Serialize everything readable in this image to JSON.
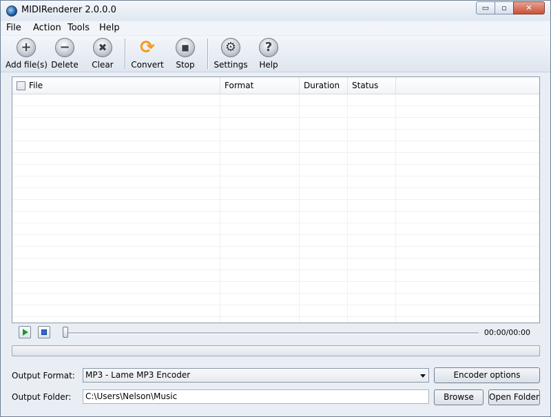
{
  "window": {
    "title": "MIDIRenderer 2.0.0.0",
    "min_glyph": "▭",
    "max_glyph": "▫",
    "close_glyph": "✕"
  },
  "menu": [
    "File",
    "Action",
    "Tools",
    "Help"
  ],
  "toolbar": {
    "add": {
      "label": "Add file(s)",
      "glyph": "+"
    },
    "delete": {
      "label": "Delete",
      "glyph": "−"
    },
    "clear": {
      "label": "Clear",
      "glyph": "✖"
    },
    "convert": {
      "label": "Convert",
      "glyph": "⟳"
    },
    "stop": {
      "label": "Stop",
      "glyph": "■"
    },
    "settings": {
      "label": "Settings",
      "glyph": "⚙"
    },
    "help": {
      "label": "Help",
      "glyph": "?"
    }
  },
  "list": {
    "columns": [
      "File",
      "Format",
      "Duration",
      "Status"
    ]
  },
  "player": {
    "time": "00:00/00:00"
  },
  "output": {
    "format_label": "Output Format:",
    "format_value": "MP3 - Lame MP3 Encoder",
    "encoder_button": "Encoder options",
    "folder_label": "Output Folder:",
    "folder_value": "C:\\Users\\Nelson\\Music",
    "browse_button": "Browse",
    "open_folder_button": "Open Folder"
  },
  "colors": {
    "accent": "#f29b1d",
    "play": "#1d9a2a",
    "stop": "#2e6ad6",
    "close": "#c8513a"
  }
}
